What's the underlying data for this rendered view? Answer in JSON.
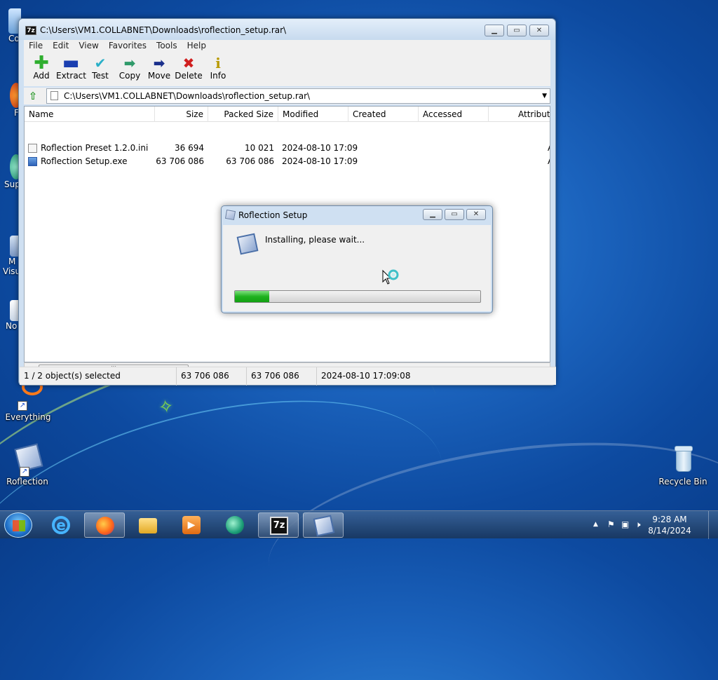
{
  "window": {
    "title": "C:\\Users\\VM1.COLLABNET\\Downloads\\roflection_setup.rar\\",
    "menu": [
      "File",
      "Edit",
      "View",
      "Favorites",
      "Tools",
      "Help"
    ],
    "toolbar": {
      "add": "Add",
      "extract": "Extract",
      "test": "Test",
      "copy": "Copy",
      "move": "Move",
      "delete": "Delete",
      "info": "Info"
    },
    "address": "C:\\Users\\VM1.COLLABNET\\Downloads\\roflection_setup.rar\\",
    "columns": {
      "name": "Name",
      "size": "Size",
      "packed": "Packed Size",
      "modified": "Modified",
      "created": "Created",
      "accessed": "Accessed",
      "attributes": "Attribute"
    },
    "files": [
      {
        "name": "Roflection Preset 1.2.0.ini",
        "size": "36 694",
        "packed": "10 021",
        "modified": "2024-08-10 17:09",
        "attr": "A"
      },
      {
        "name": "Roflection Setup.exe",
        "size": "63 706 086",
        "packed": "63 706 086",
        "modified": "2024-08-10 17:09",
        "attr": "A"
      }
    ],
    "status": {
      "selection": "1 / 2 object(s) selected",
      "size": "63 706 086",
      "packed": "63 706 086",
      "modified": "2024-08-10 17:09:08"
    }
  },
  "dialog": {
    "title": "Roflection Setup",
    "message": "Installing, please wait...",
    "progress_percent": 14
  },
  "desktop": {
    "icons": {
      "everything": "Everything",
      "roflection": "Roflection",
      "recycle_bin": "Recycle Bin"
    },
    "partial_labels": {
      "computer": "Co",
      "firefox": "F",
      "sup": "Sup",
      "visual_1": "M",
      "visual_2": "Visu",
      "notepad": "No"
    }
  },
  "taskbar": {
    "time": "9:28 AM",
    "date": "8/14/2024"
  },
  "colors": {
    "progress": "#1fb21f",
    "add_icon": "#2fae2f",
    "delete_icon": "#d01f1f",
    "move_icon": "#1a2f8c"
  }
}
